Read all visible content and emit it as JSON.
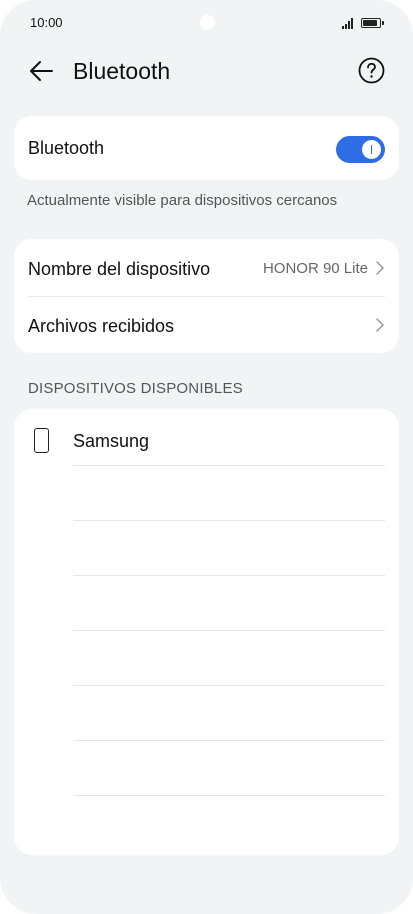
{
  "status_bar": {
    "time": "10:00"
  },
  "header": {
    "title": "Bluetooth"
  },
  "bluetooth": {
    "label": "Bluetooth",
    "enabled": true,
    "visibility_text": "Actualmente visible para dispositivos cercanos"
  },
  "device_settings": [
    {
      "label": "Nombre del dispositivo",
      "value": "HONOR 90 Lite"
    },
    {
      "label": "Archivos recibidos",
      "value": ""
    }
  ],
  "available_devices": {
    "title": "DISPOSITIVOS DISPONIBLES",
    "items": [
      {
        "name": "Samsung",
        "icon": "phone-icon"
      }
    ]
  },
  "colors": {
    "accent": "#2e6de6",
    "background": "#f1f3f5"
  }
}
